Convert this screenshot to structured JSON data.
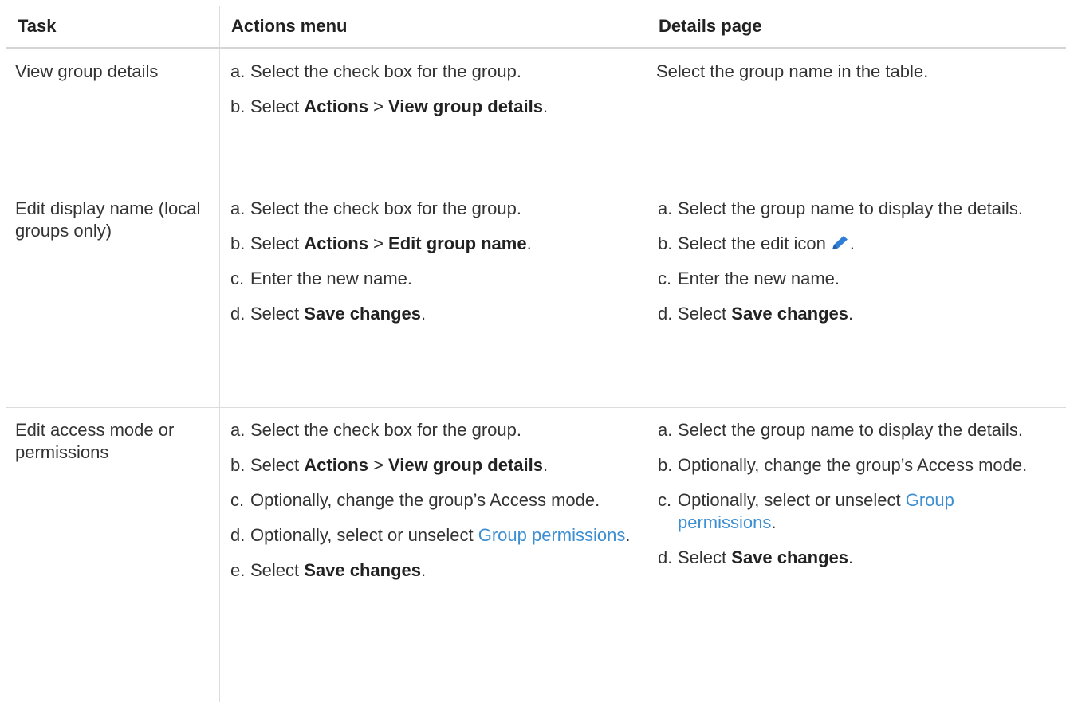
{
  "header": {
    "task": "Task",
    "actions_menu": "Actions menu",
    "details_page": "Details page"
  },
  "rows": [
    {
      "task": "View group details",
      "actions": {
        "a": {
          "marker": "a.",
          "text": "Select the check box for the group."
        },
        "b": {
          "marker": "b.",
          "pre": "Select ",
          "bold1": "Actions",
          "mid": " > ",
          "bold2": "View group details",
          "post": "."
        }
      },
      "details_text": "Select the group name in the table."
    },
    {
      "task": "Edit display name (local groups only)",
      "actions": {
        "a": {
          "marker": "a.",
          "text": "Select the check box for the group."
        },
        "b": {
          "marker": "b.",
          "pre": "Select ",
          "bold1": "Actions",
          "mid": " > ",
          "bold2": "Edit group name",
          "post": "."
        },
        "c": {
          "marker": "c.",
          "text": "Enter the new name."
        },
        "d": {
          "marker": "d.",
          "pre": "Select ",
          "bold": "Save changes",
          "post": "."
        }
      },
      "details": {
        "a": {
          "marker": "a.",
          "text": "Select the group name to display the details."
        },
        "b": {
          "marker": "b.",
          "pre": "Select the edit icon",
          "post": "."
        },
        "c": {
          "marker": "c.",
          "text": "Enter the new name."
        },
        "d": {
          "marker": "d.",
          "pre": "Select ",
          "bold": "Save changes",
          "post": "."
        }
      }
    },
    {
      "task": "Edit access mode or permissions",
      "actions": {
        "a": {
          "marker": "a.",
          "text": "Select the check box for the group."
        },
        "b": {
          "marker": "b.",
          "pre": "Select ",
          "bold1": "Actions",
          "mid": " > ",
          "bold2": "View group details",
          "post": "."
        },
        "c": {
          "marker": "c.",
          "text": "Optionally, change the group’s Access mode."
        },
        "d": {
          "marker": "d.",
          "pre": "Optionally, select or unselect ",
          "link": "Group permissions",
          "post": "."
        },
        "e": {
          "marker": "e.",
          "pre": "Select ",
          "bold": "Save changes",
          "post": "."
        }
      },
      "details": {
        "a": {
          "marker": "a.",
          "text": "Select the group name to display the details."
        },
        "b": {
          "marker": "b.",
          "text": "Optionally, change the group’s Access mode."
        },
        "c": {
          "marker": "c.",
          "pre": "Optionally, select or unselect ",
          "link": "Group permissions",
          "post": "."
        },
        "d": {
          "marker": "d.",
          "pre": "Select ",
          "bold": "Save changes",
          "post": "."
        }
      }
    }
  ],
  "colors": {
    "link": "#3d8fd1",
    "edit_icon": "#2f7fd8"
  },
  "icons": {
    "edit": "pencil-icon"
  }
}
